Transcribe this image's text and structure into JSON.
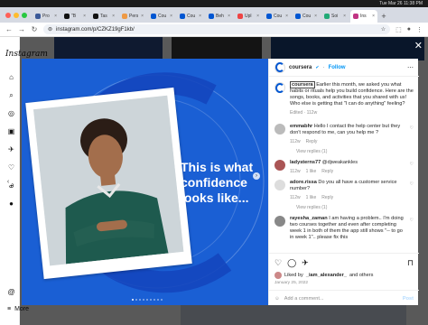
{
  "os": {
    "time": "Tue Mar 26  11:38 PM"
  },
  "tabs": [
    "Pro",
    "\"B",
    "Tas",
    "Pers",
    "Cou",
    "Cou",
    "Beh",
    "Upl",
    "Cou",
    "Cou",
    "Soi",
    "Ins"
  ],
  "address": {
    "url": "instagram.com/p/CZKZ19gF1kb/"
  },
  "app": {
    "name": "Instagram",
    "more_label": "More"
  },
  "post": {
    "headline_lines": [
      "This is what",
      "confidence",
      "looks like..."
    ],
    "account": "coursera",
    "follow_label": "Follow",
    "caption_name": "coursera",
    "caption_text": "Earlier this month, we asked you what habits or rituals help you build confidence. Here are the songs, books, and activities that you shared with us! Who else is getting that \"I can do anything\" feeling?",
    "caption_meta": "Edited · 112w",
    "comments": [
      {
        "user": "emmabhr",
        "text": "Hello I contact the help center but they don't respond to me, can you help me ?",
        "time": "112w",
        "reply": "Reply"
      },
      {
        "user": "ladysterns77",
        "text": "@djweakankles",
        "time": "112w",
        "likes": "1 like",
        "reply": "Reply"
      },
      {
        "user": "adore.rissa",
        "text": "Do you all have a customer service number?",
        "time": "112w",
        "likes": "1 like",
        "reply": "Reply"
      },
      {
        "user": "rayesha_zaman",
        "text": "I am having a problem.. I'm doing two courses together and even after completing week 1 in both of them the app still shows \"-- to go in week 1\".. please fix this",
        "time": "",
        "reply": ""
      }
    ],
    "view_replies": [
      "View replies (1)",
      "View replies (1)"
    ],
    "liked_by_prefix": "Liked by",
    "liked_by_user": "_iam_alexander_",
    "liked_by_suffix": "and others",
    "date": "January 25, 2022",
    "add_comment_placeholder": "Add a comment...",
    "post_label": "Post"
  },
  "colors": {
    "brand_blue": "#0056d2",
    "follow": "#0095f6"
  }
}
